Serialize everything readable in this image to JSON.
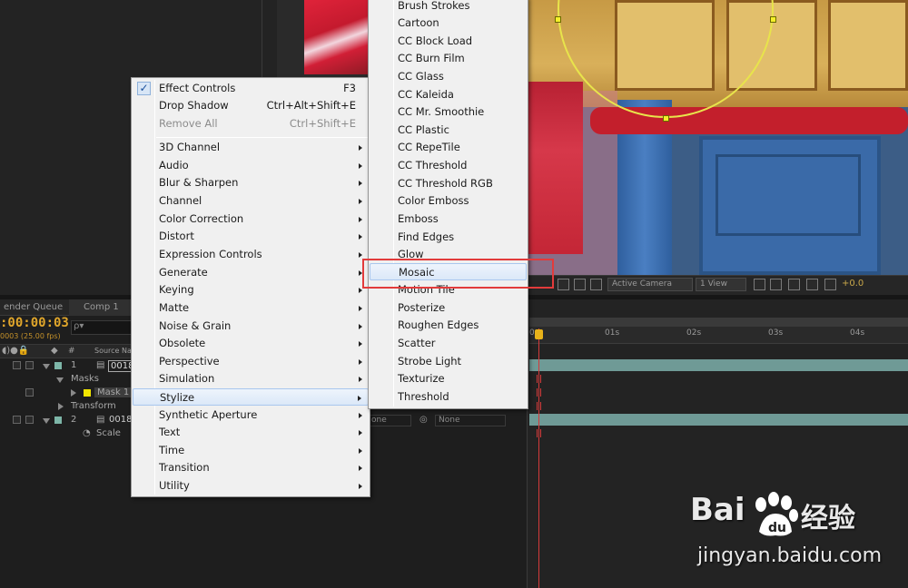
{
  "viewer_toolbar": {
    "camera": "Active Camera",
    "views": "1 View",
    "exposure": "+0.0"
  },
  "timeline": {
    "tabs": [
      "ender Queue",
      "Comp 1"
    ],
    "timecode": ":00:00:03",
    "fps": "0003 (25.00 fps)",
    "search_placeholder": "ρ▾",
    "column_source_name": "Source Na",
    "layers": [
      {
        "num": "1",
        "name": "0018"
      },
      {
        "num": "2",
        "name": "0018"
      }
    ],
    "props": {
      "masks": "Masks",
      "mask1": "Mask 1",
      "transform": "Transform",
      "scale": "Scale"
    },
    "mode_none_1": "one",
    "mode_none_2": "None",
    "ruler": [
      "0s",
      "01s",
      "02s",
      "03s",
      "04s"
    ]
  },
  "menu_main": {
    "top_items": [
      {
        "label": "Effect Controls",
        "shortcut": "F3",
        "checked": true,
        "disabled": false
      },
      {
        "label": "Drop Shadow",
        "shortcut": "Ctrl+Alt+Shift+E",
        "checked": false,
        "disabled": false
      },
      {
        "label": "Remove All",
        "shortcut": "Ctrl+Shift+E",
        "checked": false,
        "disabled": true
      }
    ],
    "categories": [
      "3D Channel",
      "Audio",
      "Blur & Sharpen",
      "Channel",
      "Color Correction",
      "Distort",
      "Expression Controls",
      "Generate",
      "Keying",
      "Matte",
      "Noise & Grain",
      "Obsolete",
      "Perspective",
      "Simulation",
      "Stylize",
      "Synthetic Aperture",
      "Text",
      "Time",
      "Transition",
      "Utility"
    ],
    "highlighted": "Stylize"
  },
  "menu_stylize": {
    "items": [
      "Brush Strokes",
      "Cartoon",
      "CC Block Load",
      "CC Burn Film",
      "CC Glass",
      "CC Kaleida",
      "CC Mr. Smoothie",
      "CC Plastic",
      "CC RepeTile",
      "CC Threshold",
      "CC Threshold RGB",
      "Color Emboss",
      "Emboss",
      "Find Edges",
      "Glow",
      "Mosaic",
      "Motion Tile",
      "Posterize",
      "Roughen Edges",
      "Scatter",
      "Strobe Light",
      "Texturize",
      "Threshold"
    ],
    "highlighted": "Mosaic"
  },
  "watermark": {
    "brand": "Bai",
    "brand_cn": "经验",
    "url": "jingyan.baidu.com"
  },
  "colors": {
    "menu_bg": "#f0f0f0",
    "highlight_border": "#a9c7ee",
    "annotation_red": "#e23b3b",
    "timecode": "#e0a62b",
    "mask_path": "#e8e44b"
  }
}
